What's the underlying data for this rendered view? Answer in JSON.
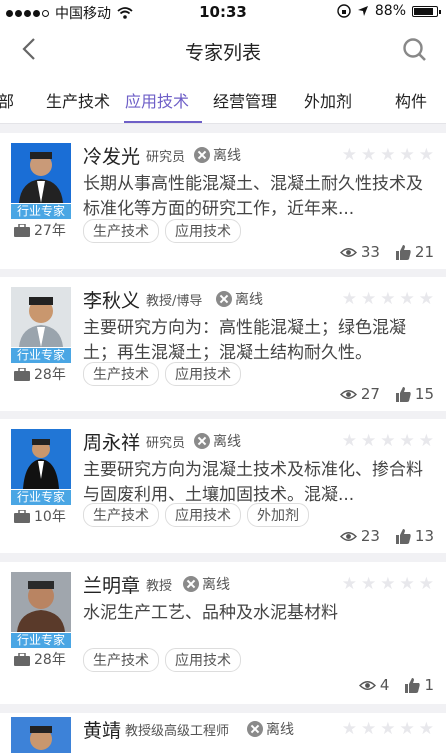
{
  "status": {
    "carrier": "中国移动",
    "time": "10:33",
    "battery": "88%"
  },
  "nav": {
    "title": "专家列表"
  },
  "tabs": [
    "部",
    "生产技术",
    "应用技术",
    "经营管理",
    "外加剂",
    "构件"
  ],
  "active_tab_index": 2,
  "experts": [
    {
      "name": "冷发光",
      "role": "研究员",
      "status": "离线",
      "badge": "行业专家",
      "years": "27年",
      "desc": "长期从事高性能混凝土、混凝土耐久性技术及标准化等方面的研究工作，近年来...",
      "tags": [
        "生产技术",
        "应用技术"
      ],
      "views": "33",
      "likes": "21"
    },
    {
      "name": "李秋义",
      "role": "教授/博导",
      "status": "离线",
      "badge": "行业专家",
      "years": "28年",
      "desc": "主要研究方向为：高性能混凝土；绿色混凝土；再生混凝土；混凝土结构耐久性。",
      "tags": [
        "生产技术",
        "应用技术"
      ],
      "views": "27",
      "likes": "15"
    },
    {
      "name": "周永祥",
      "role": "研究员",
      "status": "离线",
      "badge": "行业专家",
      "years": "10年",
      "desc": "主要研究方向为混凝土技术及标准化、掺合料与固废利用、土壤加固技术。混凝...",
      "tags": [
        "生产技术",
        "应用技术",
        "外加剂"
      ],
      "views": "23",
      "likes": "13"
    },
    {
      "name": "兰明章",
      "role": "教授",
      "status": "离线",
      "badge": "行业专家",
      "years": "28年",
      "desc": "水泥生产工艺、品种及水泥基材料",
      "tags": [
        "生产技术",
        "应用技术"
      ],
      "views": "4",
      "likes": "1"
    },
    {
      "name": "黄靖",
      "role": "教授级高级工程师",
      "status": "离线"
    }
  ]
}
